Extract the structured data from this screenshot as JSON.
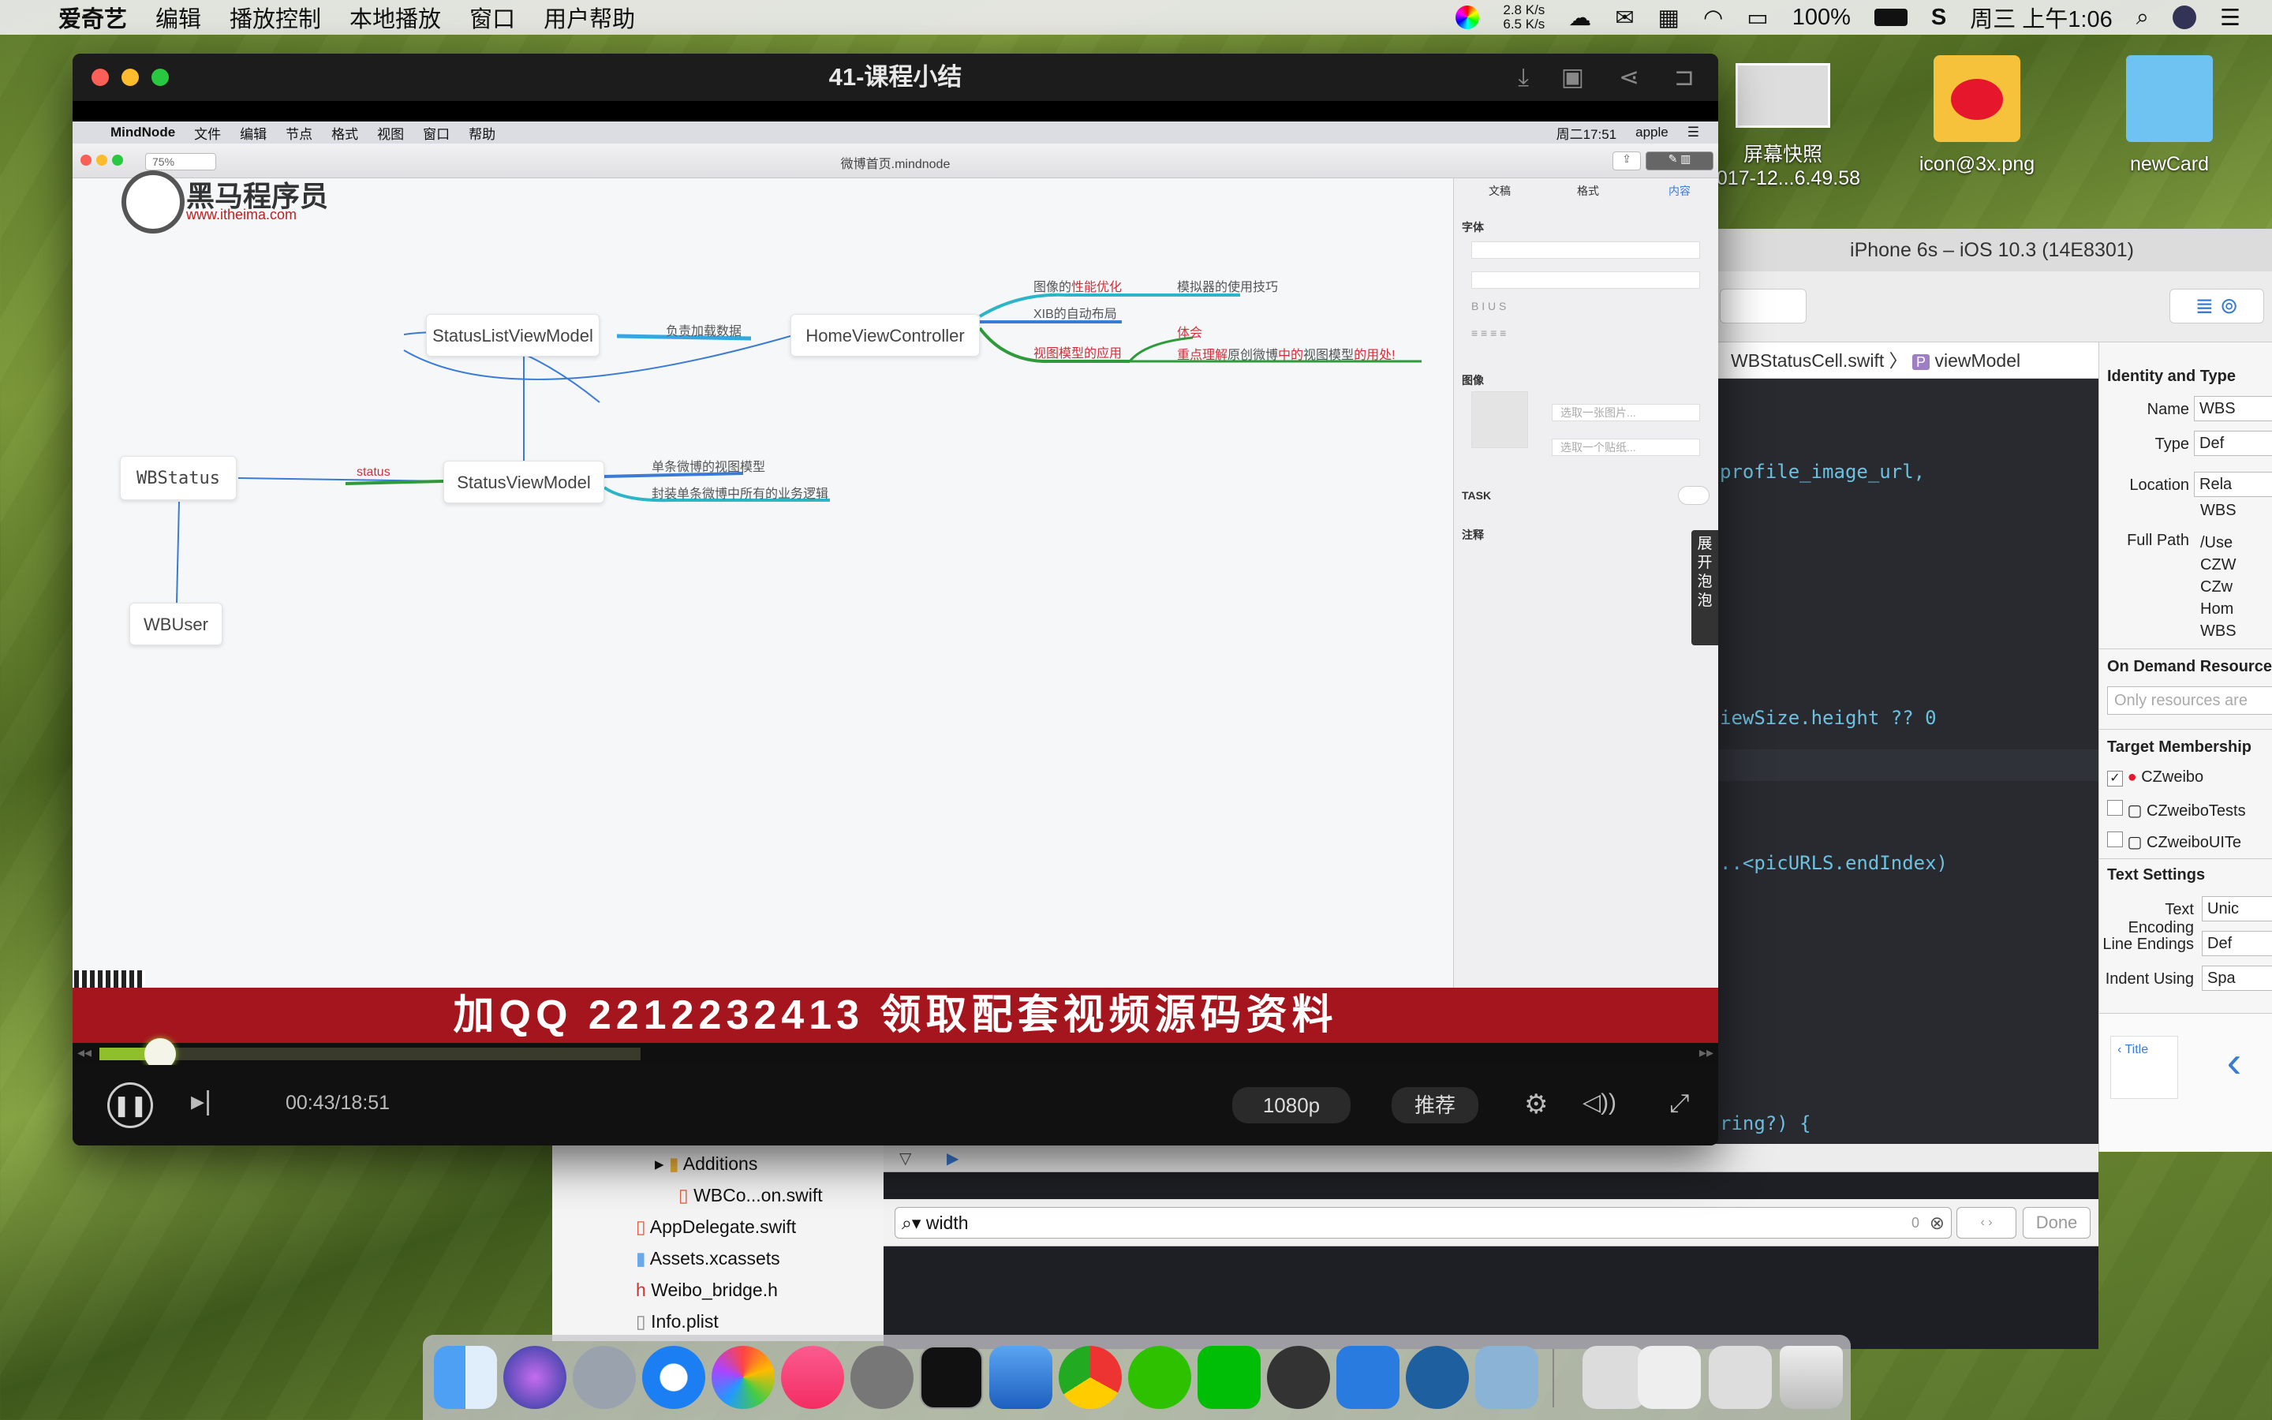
{
  "menubar": {
    "app": "爱奇艺",
    "items": [
      "编辑",
      "播放控制",
      "本地播放",
      "窗口",
      "用户帮助"
    ],
    "net_up": "2.8 K/s",
    "net_down": "6.5 K/s",
    "battery": "100%",
    "clock": "周三 上午1:06"
  },
  "desktop": {
    "icons": [
      {
        "name": "屏幕快照",
        "sub": "2017-12...6.49.58"
      },
      {
        "name": "icon@3x.png",
        "sub": ""
      },
      {
        "name": "newCard",
        "sub": ""
      }
    ]
  },
  "player": {
    "title": "41-课程小结",
    "time": "00:43/18:51",
    "quality": "1080p",
    "recommend": "推荐",
    "progress": 0.038,
    "buffered": 0.34,
    "banner": "加QQ 2212232413  领取配套视频源码资料"
  },
  "inner_menu": {
    "app": "MindNode",
    "items": [
      "文件",
      "编辑",
      "节点",
      "格式",
      "视图",
      "窗口",
      "帮助"
    ],
    "clock": "周二17:51",
    "user": "apple"
  },
  "mindnode": {
    "zoom": "75%",
    "doc": "微博首页.mindnode",
    "logo": "黑马程序员",
    "logo_url": "www.itheima.com",
    "tabs": [
      "文稿",
      "格式",
      "内容"
    ],
    "panel": {
      "font": "字体",
      "image": "图像",
      "image_choose": "选取一张图片...",
      "image_sticker": "选取一个贴纸...",
      "task": "TASK",
      "notes": "注释"
    },
    "side_toggle": "展开泡泡",
    "nodes": {
      "list_vm": "StatusListViewModel",
      "home_vc": "HomeViewController",
      "status_vm": "StatusViewModel",
      "wbstatus": "WBStatus",
      "wbuser": "WBUser"
    },
    "labels": {
      "load": "负责加载数据",
      "perf_a": "图像的",
      "perf_b": "性能优化",
      "simulator": "模拟器的使用技巧",
      "xib": "XIB的自动布局",
      "vm_use": "视图模型的应用",
      "insight": "体会",
      "key_a": "重点理解",
      "key_b": "原创微博",
      "key_c": "中的",
      "key_d": "视图模型",
      "key_e": "的用处!",
      "status": "status",
      "single_vm": "单条微博的视图模型",
      "encap": "封装单条微博中所有的业务逻辑"
    }
  },
  "simulator": {
    "title": "iPhone 6s – iOS 10.3 (14E8301)"
  },
  "xcode": {
    "breadcrumb_file": "WBStatusCell.swift",
    "breadcrumb_sym": "viewModel",
    "code": [
      "profile_image_url,",
      "iewSize.height ?? 0",
      "..<picURLS.endIndex)",
      "ring?) {"
    ],
    "inspector": {
      "identity": "Identity and Type",
      "name_label": "Name",
      "name_val": "WBS",
      "type_label": "Type",
      "type_val": "Def",
      "location_label": "Location",
      "location_val": "Rela",
      "loc2": "WBS",
      "fullpath_label": "Full Path",
      "fullpath": [
        "/Use",
        "CZW",
        "CZw",
        "Hom",
        "WBS"
      ],
      "on_demand": "On Demand Resource",
      "only_res": "Only resources are",
      "target": "Target Membership",
      "targets": [
        "CZweibo",
        "CZweiboTests",
        "CZweiboUITe"
      ],
      "text_settings": "Text Settings",
      "encoding_label": "Text Encoding",
      "encoding_val": "Unic",
      "endings_label": "Line Endings",
      "endings_val": "Def",
      "indent_label": "Indent Using",
      "indent_val": "Spa",
      "lib_title": "Title"
    },
    "navigator": [
      "Additions",
      "WBCo...on.swift",
      "AppDelegate.swift",
      "Assets.xcassets",
      "Weibo_bridge.h",
      "Info.plist"
    ],
    "find": {
      "query": "width",
      "count": "0",
      "done": "Done"
    }
  },
  "colors": {
    "banner": "#a5151d",
    "accent": "#3a7bd5"
  }
}
